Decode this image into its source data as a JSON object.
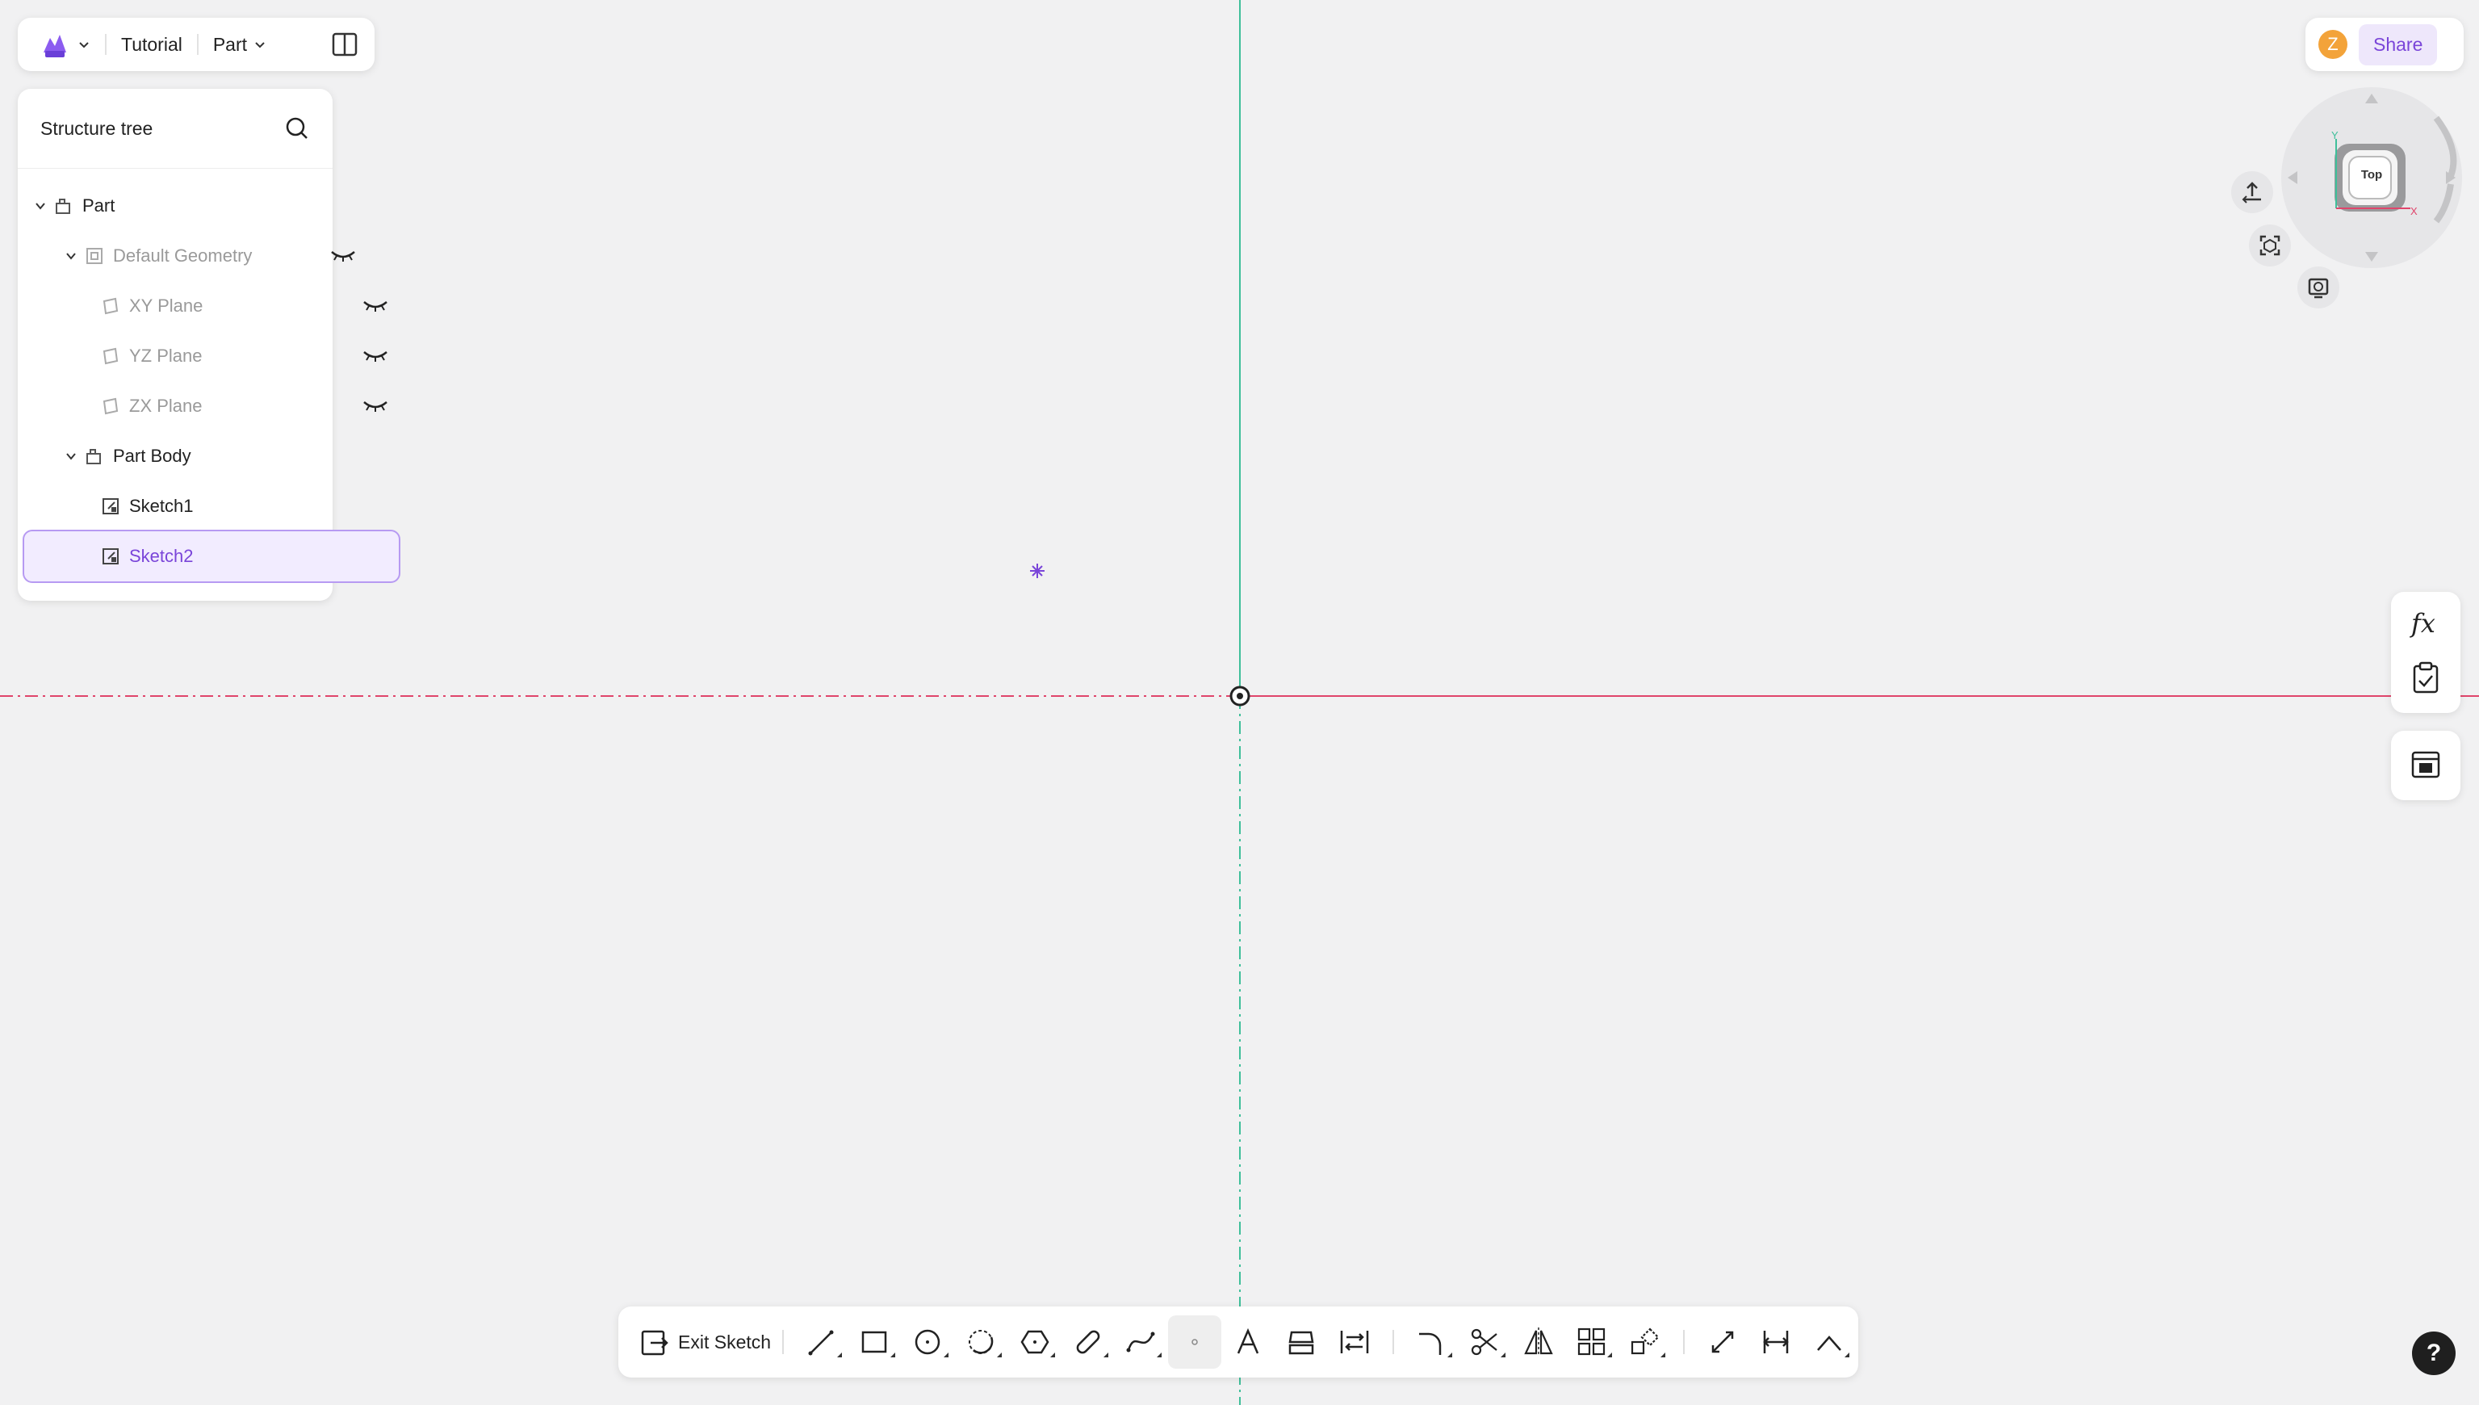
{
  "topbar": {
    "breadcrumb": "Tutorial",
    "mode_menu": "Part"
  },
  "tree": {
    "title": "Structure tree",
    "items": [
      {
        "label": "Part"
      },
      {
        "label": "Default Geometry"
      },
      {
        "label": "XY Plane"
      },
      {
        "label": "YZ Plane"
      },
      {
        "label": "ZX Plane"
      },
      {
        "label": "Part Body"
      },
      {
        "label": "Sketch1"
      },
      {
        "label": "Sketch2"
      }
    ]
  },
  "user": {
    "avatar_initial": "Z",
    "share_label": "Share"
  },
  "viewcube": {
    "face_label": "Top",
    "axis_y": "Y",
    "axis_x": "X"
  },
  "toolbar": {
    "exit_label": "Exit Sketch"
  },
  "help": {
    "label": "?"
  },
  "colors": {
    "accent": "#7a45d9",
    "axis_vertical": "#3fbf9a",
    "axis_horizontal": "#e0456b",
    "canvas": "#f1f1f2"
  }
}
